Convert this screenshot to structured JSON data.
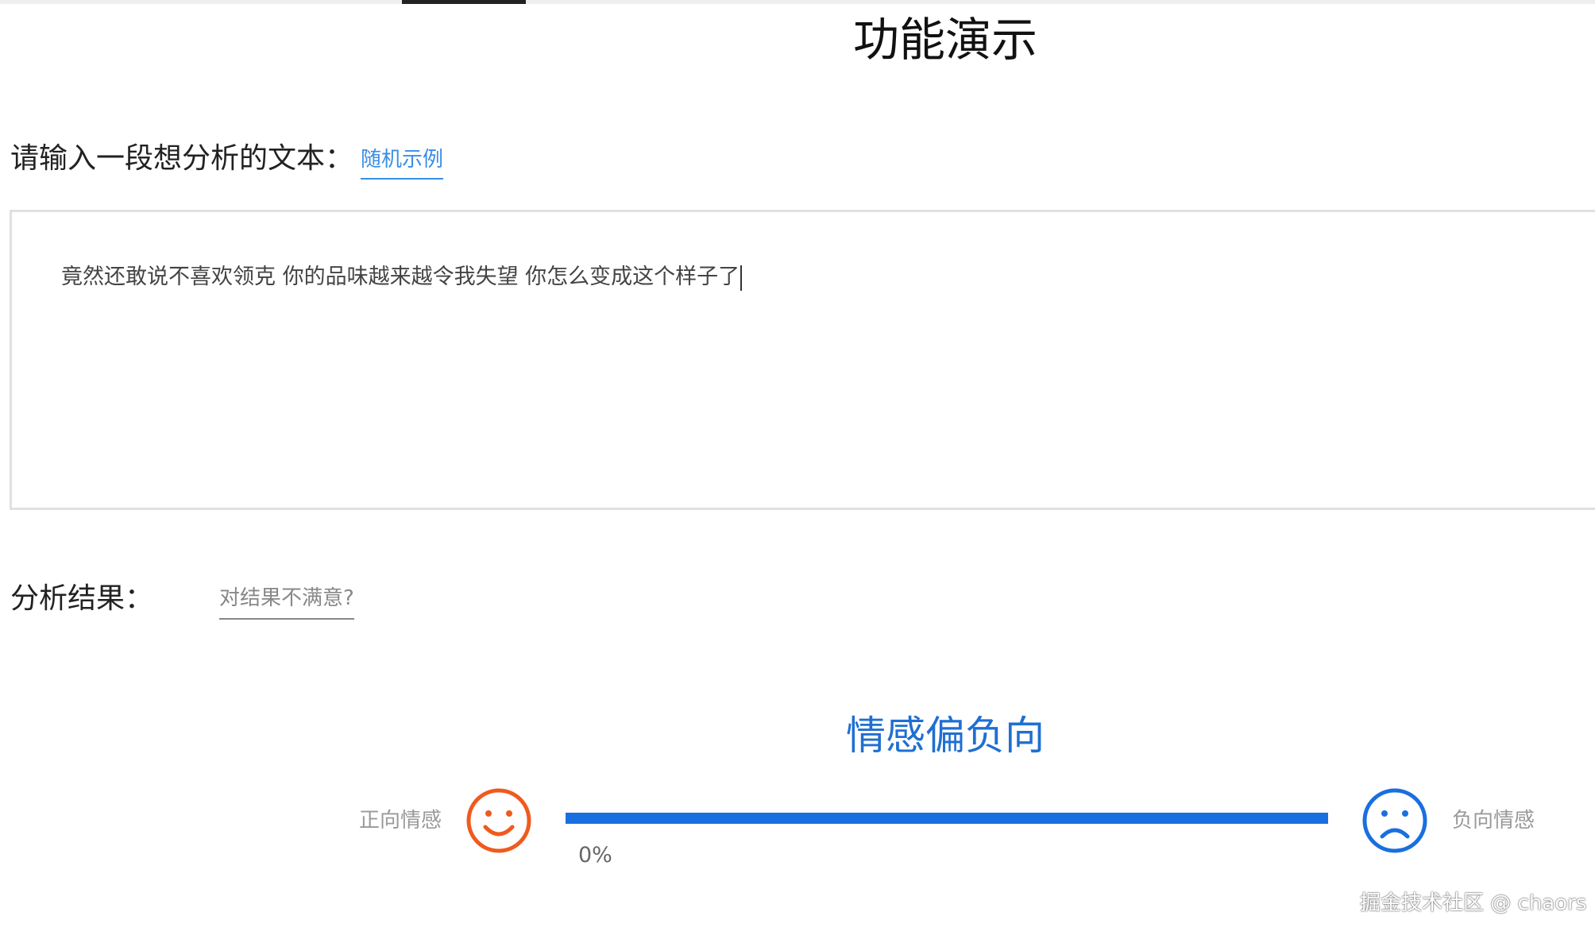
{
  "page": {
    "title": "功能演示"
  },
  "input_section": {
    "label": "请输入一段想分析的文本：",
    "random_example_link": "随机示例",
    "text_value": "竟然还敢说不喜欢领克  你的品味越来越令我失望  你怎么变成这个样子了"
  },
  "result_section": {
    "label": "分析结果：",
    "dissatisfied_link": "对结果不满意?",
    "sentiment_result": "情感偏负向",
    "positive_label": "正向情感",
    "negative_label": "负向情感",
    "positive_percent_text": "0%",
    "positive_fraction": 0
  },
  "icons": {
    "positive": "smile-face-icon",
    "negative": "sad-face-icon"
  },
  "colors": {
    "accent_blue": "#1a6fe0",
    "link_blue": "#3a8ee6",
    "positive_orange": "#f05a1e",
    "result_text_blue": "#1f6fd1"
  },
  "watermark": "掘金技术社区 @ chaors"
}
